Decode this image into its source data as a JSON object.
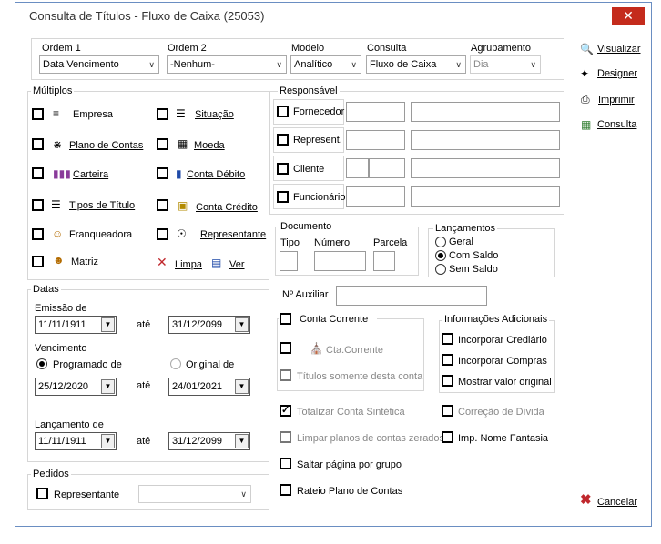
{
  "window": {
    "title": "Consulta de Títulos - Fluxo de Caixa (25053)",
    "close": "✕"
  },
  "top": {
    "ordem1": {
      "label": "Ordem 1",
      "value": "Data Vencimento"
    },
    "ordem2": {
      "label": "Ordem 2",
      "value": "-Nenhum-"
    },
    "modelo": {
      "label": "Modelo",
      "value": "Analítico"
    },
    "consulta": {
      "label": "Consulta",
      "value": "Fluxo de Caixa"
    },
    "agrupamento": {
      "label": "Agrupamento",
      "value": "Dia"
    }
  },
  "multiplos": {
    "title": "Múltiplos",
    "empresa": "Empresa",
    "situacao": "Situação",
    "plano": "Plano de Contas",
    "moeda": "Moeda",
    "carteira": "Carteira",
    "conta_debito": "Conta Débito",
    "tipos": "Tipos de Título",
    "conta_credito": "Conta Crédito",
    "franqueadora": "Franqueadora",
    "representante": "Representante",
    "matriz": "Matriz",
    "limpa": "Limpa",
    "ver": "Ver"
  },
  "responsavel": {
    "title": "Responsável",
    "fornecedor": "Fornecedor",
    "represent": "Represent.",
    "cliente": "Cliente",
    "funcionario": "Funcionário"
  },
  "documento": {
    "title": "Documento",
    "tipo": "Tipo",
    "numero": "Número",
    "parcela": "Parcela"
  },
  "lancamentos": {
    "title": "Lançamentos",
    "geral": "Geral",
    "com_saldo": "Com Saldo",
    "sem_saldo": "Sem Saldo"
  },
  "nro_auxiliar": "Nº Auxiliar",
  "conta_corrente": {
    "title": "Conta Corrente",
    "cta": "Cta.Corrente",
    "somente": "Títulos somente desta conta"
  },
  "info_adic": {
    "title": "Informações Adicionais",
    "crediario": "Incorporar Crediário",
    "compras": "Incorporar Compras",
    "mostrar": "Mostrar valor original"
  },
  "opcoes": {
    "totalizar": "Totalizar Conta Sintética",
    "correcao": "Correção de Dívida",
    "limpar": "Limpar planos de contas zerados",
    "imp_nome": "Imp. Nome Fantasia",
    "saltar": "Saltar página por grupo",
    "rateio": "Rateio Plano de Contas"
  },
  "datas": {
    "title": "Datas",
    "emissao": {
      "label": "Emissão de",
      "from": "11/11/1911",
      "to": "31/12/2099"
    },
    "ate": "até",
    "vencimento": {
      "label": "Vencimento",
      "programado": "Programado de",
      "original": "Original de",
      "from": "25/12/2020",
      "to": "24/01/2021"
    },
    "lancamento": {
      "label": "Lançamento de",
      "from": "11/11/1911",
      "to": "31/12/2099"
    }
  },
  "pedidos": {
    "title": "Pedidos",
    "representante": "Representante"
  },
  "side": {
    "visualizar": "Visualizar",
    "designer": "Designer",
    "imprimir": "Imprimir",
    "consulta": "Consulta",
    "cancelar": "Cancelar"
  }
}
